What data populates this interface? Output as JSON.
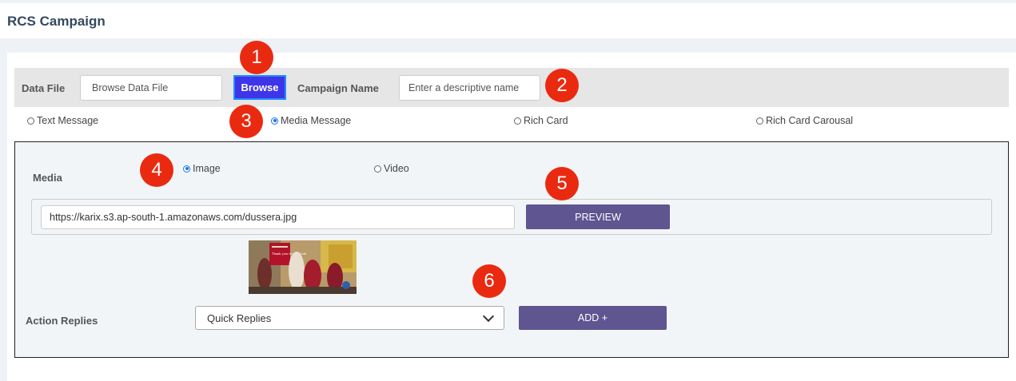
{
  "page": {
    "title": "RCS Campaign"
  },
  "file_bar": {
    "data_file_label": "Data File",
    "data_file_placeholder": "Browse Data File",
    "browse_label": "Browse",
    "campaign_name_label": "Campaign Name",
    "campaign_name_placeholder": "Enter a descriptive name"
  },
  "message_types": [
    {
      "label": "Text Message",
      "selected": false
    },
    {
      "label": "Media Message",
      "selected": true
    },
    {
      "label": "Rich Card",
      "selected": false
    },
    {
      "label": "Rich Card Carousal",
      "selected": false
    }
  ],
  "media": {
    "label": "Media",
    "options": [
      {
        "label": "Image",
        "selected": true
      },
      {
        "label": "Video",
        "selected": false
      }
    ],
    "url_value": "https://karix.s3.ap-south-1.amazonaws.com/dussera.jpg",
    "preview_label": "PREVIEW",
    "thumbnail_text": "Thank your festive look"
  },
  "action_replies": {
    "label": "Action Replies",
    "selected_option": "Quick Replies",
    "add_label": "ADD +"
  },
  "badges": [
    "1",
    "2",
    "3",
    "4",
    "5",
    "6"
  ],
  "colors": {
    "accent_purple": "#5f5591",
    "browse_blue": "#3f35e8",
    "badge_red": "#ea2a10",
    "radio_blue": "#1a73e8"
  }
}
